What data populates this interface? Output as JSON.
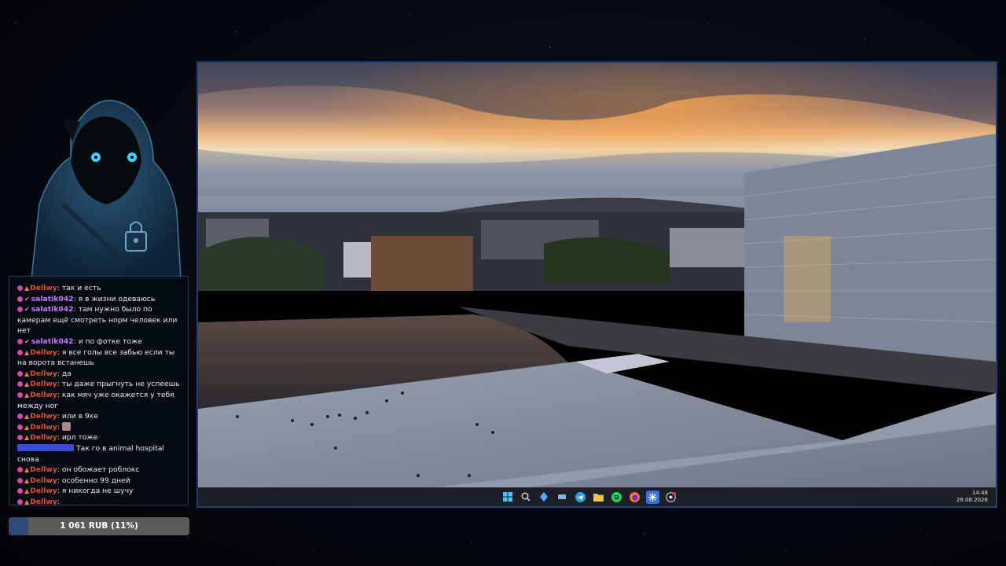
{
  "chat": {
    "messages": [
      {
        "user": "Dellwy",
        "color": "#e0502c",
        "text": "так и есть",
        "badges": [
          "heart",
          "vip"
        ]
      },
      {
        "user": "salatik042",
        "color": "#c878ff",
        "text": "я в жизни одеваюсь",
        "badges": [
          "heart",
          "sub"
        ]
      },
      {
        "user": "salatik042",
        "color": "#c878ff",
        "text": "там нужно было по камерам ещё смотреть норм человек или нет",
        "badges": [
          "heart",
          "sub"
        ]
      },
      {
        "user": "salatik042",
        "color": "#c878ff",
        "text": "и по фотке тоже",
        "badges": [
          "heart",
          "sub"
        ]
      },
      {
        "user": "Dellwy",
        "color": "#e0502c",
        "text": "я все голы все забью если ты на ворота встанешь",
        "badges": [
          "heart",
          "vip"
        ]
      },
      {
        "user": "Dellwy",
        "color": "#e0502c",
        "text": "да",
        "badges": [
          "heart",
          "vip"
        ]
      },
      {
        "user": "Dellwy",
        "color": "#e0502c",
        "text": "ты даже прыгнуть не успеешь",
        "badges": [
          "heart",
          "vip"
        ]
      },
      {
        "user": "Dellwy",
        "color": "#e0502c",
        "text": "как мяч уже окажется у тебя между ног",
        "badges": [
          "heart",
          "vip"
        ]
      },
      {
        "user": "Dellwy",
        "color": "#e0502c",
        "text": "или в 9ке",
        "badges": [
          "heart",
          "vip"
        ]
      },
      {
        "user": "Dellwy",
        "color": "#e0502c",
        "text": "",
        "emote": true,
        "badges": [
          "heart",
          "vip"
        ]
      },
      {
        "user": "Dellwy",
        "color": "#e0502c",
        "text": "ирл тоже",
        "badges": [
          "heart",
          "vip"
        ]
      },
      {
        "user": "",
        "color": "#3a4cd8",
        "text": "Так го в animal hospital снова",
        "badges": []
      },
      {
        "user": "Dellwy",
        "color": "#e0502c",
        "text": "он обожает роблокс",
        "badges": [
          "heart",
          "vip"
        ]
      },
      {
        "user": "Dellwy",
        "color": "#e0502c",
        "text": "особенно 99 дней",
        "badges": [
          "heart",
          "vip"
        ]
      },
      {
        "user": "Dellwy",
        "color": "#e0502c",
        "text": "я никогда не шучу",
        "badges": [
          "heart",
          "vip"
        ]
      },
      {
        "user": "Dellwy",
        "color": "#e0502c",
        "text": "",
        "badges": [
          "heart",
          "vip"
        ]
      }
    ]
  },
  "donation": {
    "label": "1 061 RUB (11%)",
    "progress": 0.11
  },
  "taskbar": {
    "time": "14:48",
    "date": "28.08.2026",
    "icons": [
      "windows-icon",
      "search-icon",
      "app-icon",
      "app2-icon",
      "telegram-icon",
      "folder-icon",
      "spotify-icon",
      "firefox-icon",
      "snowflake-icon",
      "obs-icon"
    ]
  }
}
